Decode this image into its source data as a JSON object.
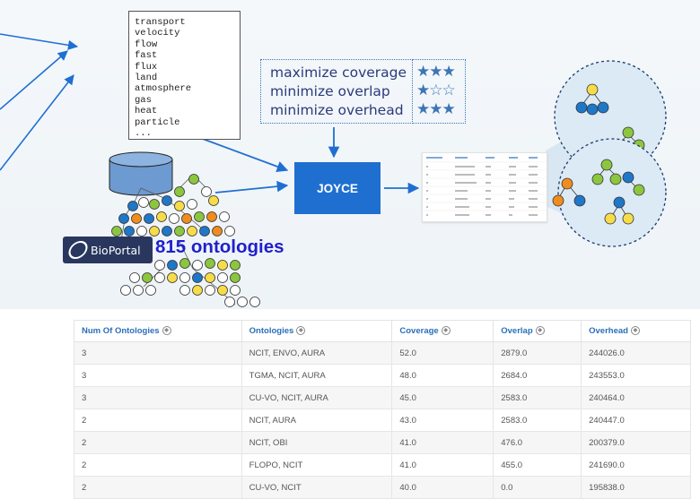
{
  "keywords": [
    "transport",
    "velocity",
    "flow",
    "fast",
    "flux",
    "land",
    "atmosphere",
    "gas",
    "heat",
    "particle",
    "..."
  ],
  "objectives": [
    {
      "label": "maximize coverage",
      "stars": "★★★"
    },
    {
      "label": "minimize overlap",
      "stars": "★☆☆"
    },
    {
      "label": "minimize overhead",
      "stars": "★★★"
    }
  ],
  "joyce_label": "JOYCE",
  "bioportal": {
    "brand": "BioPortal",
    "count_label": "815 ontologies"
  },
  "colors": {
    "accent": "#1f6fd1",
    "header_text": "#2b6fb8",
    "count_text": "#1f1fcc",
    "bioportal_bg": "#29375f",
    "node_blue": "#1f77c8",
    "node_green": "#8cc63f",
    "node_yellow": "#f7dc4a",
    "node_orange": "#f08c1e",
    "node_gray": "#ffffff"
  },
  "table": {
    "headers": [
      "Num Of Ontologies",
      "Ontologies",
      "Coverage",
      "Overlap",
      "Overhead"
    ],
    "rows": [
      [
        "3",
        "NCIT, ENVO, AURA",
        "52.0",
        "2879.0",
        "244026.0"
      ],
      [
        "3",
        "TGMA, NCIT, AURA",
        "48.0",
        "2684.0",
        "243553.0"
      ],
      [
        "3",
        "CU-VO, NCIT, AURA",
        "45.0",
        "2583.0",
        "240464.0"
      ],
      [
        "2",
        "NCIT, AURA",
        "43.0",
        "2583.0",
        "240447.0"
      ],
      [
        "2",
        "NCIT, OBI",
        "41.0",
        "476.0",
        "200379.0"
      ],
      [
        "2",
        "FLOPO, NCIT",
        "41.0",
        "455.0",
        "241690.0"
      ],
      [
        "2",
        "CU-VO, NCIT",
        "40.0",
        "0.0",
        "195838.0"
      ]
    ]
  }
}
